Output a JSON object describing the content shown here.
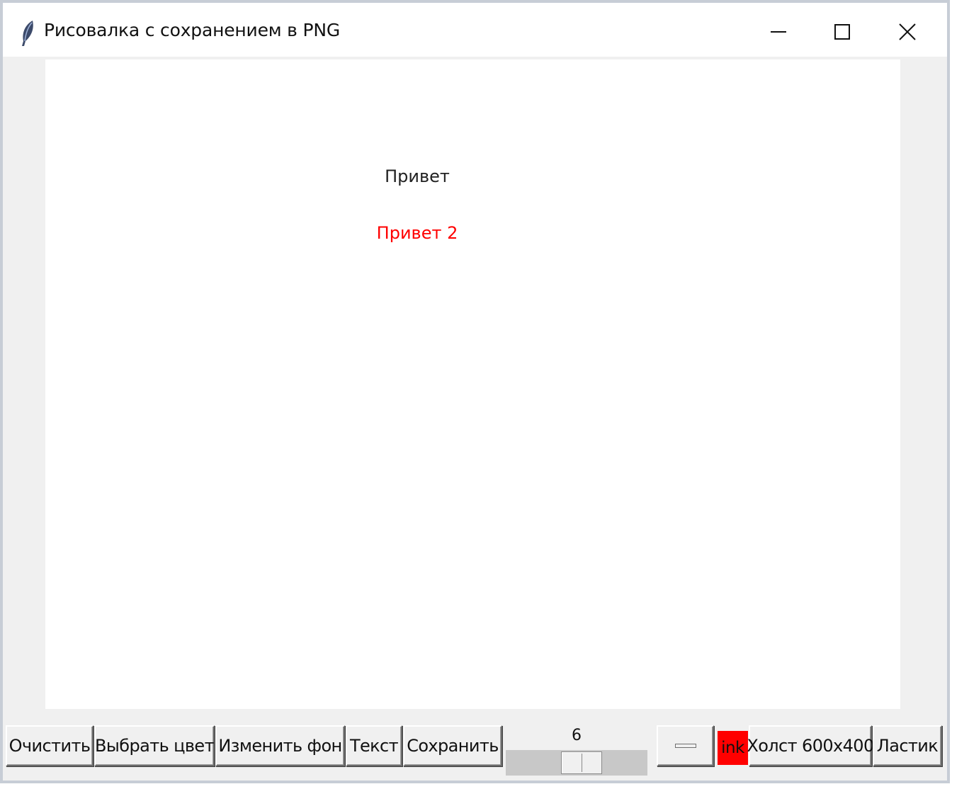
{
  "window": {
    "title": "Рисовалка с сохранением в PNG",
    "controls": [
      "minimize-icon",
      "maximize-icon",
      "close-icon"
    ]
  },
  "canvas": {
    "background": "#ffffff",
    "texts": [
      {
        "text": "Привет",
        "color": "#222222"
      },
      {
        "text": "Привет 2",
        "color": "#ff0000"
      }
    ]
  },
  "toolbar": {
    "clear_label": "Очистить",
    "pick_color_label": "Выбрать цвет",
    "change_bg_label": "Изменить фон",
    "text_label": "Текст",
    "save_label": "Сохранить",
    "brush_size": "6",
    "color_swatch_label": "ink",
    "color_swatch_color": "#ff0000",
    "canvas_size_label": "Холст 600x400",
    "eraser_label": "Ластик"
  }
}
